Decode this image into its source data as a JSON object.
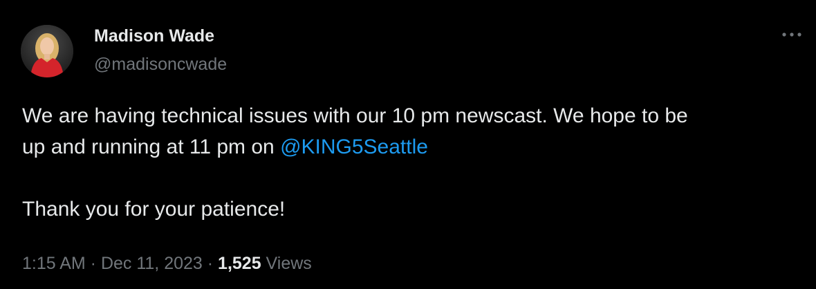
{
  "author": {
    "name": "Madison Wade",
    "handle": "@madisoncwade",
    "avatar_icon": "profile-photo"
  },
  "more_icon": "more-horizontal-icon",
  "post": {
    "line1": "We are having technical issues with our 10 pm newscast. We hope to be",
    "line2_prefix": "up and running at 11 pm on ",
    "mention": "@KING5Seattle",
    "line3": "Thank you for your patience!"
  },
  "meta": {
    "time": "1:15 AM",
    "separator1": " · ",
    "date": "Dec 11, 2023",
    "separator2": " · ",
    "views_count": "1,525",
    "views_label": " Views"
  },
  "colors": {
    "background": "#000000",
    "text": "#e7e9ea",
    "secondary": "#71767b",
    "link": "#1d9bf0"
  }
}
